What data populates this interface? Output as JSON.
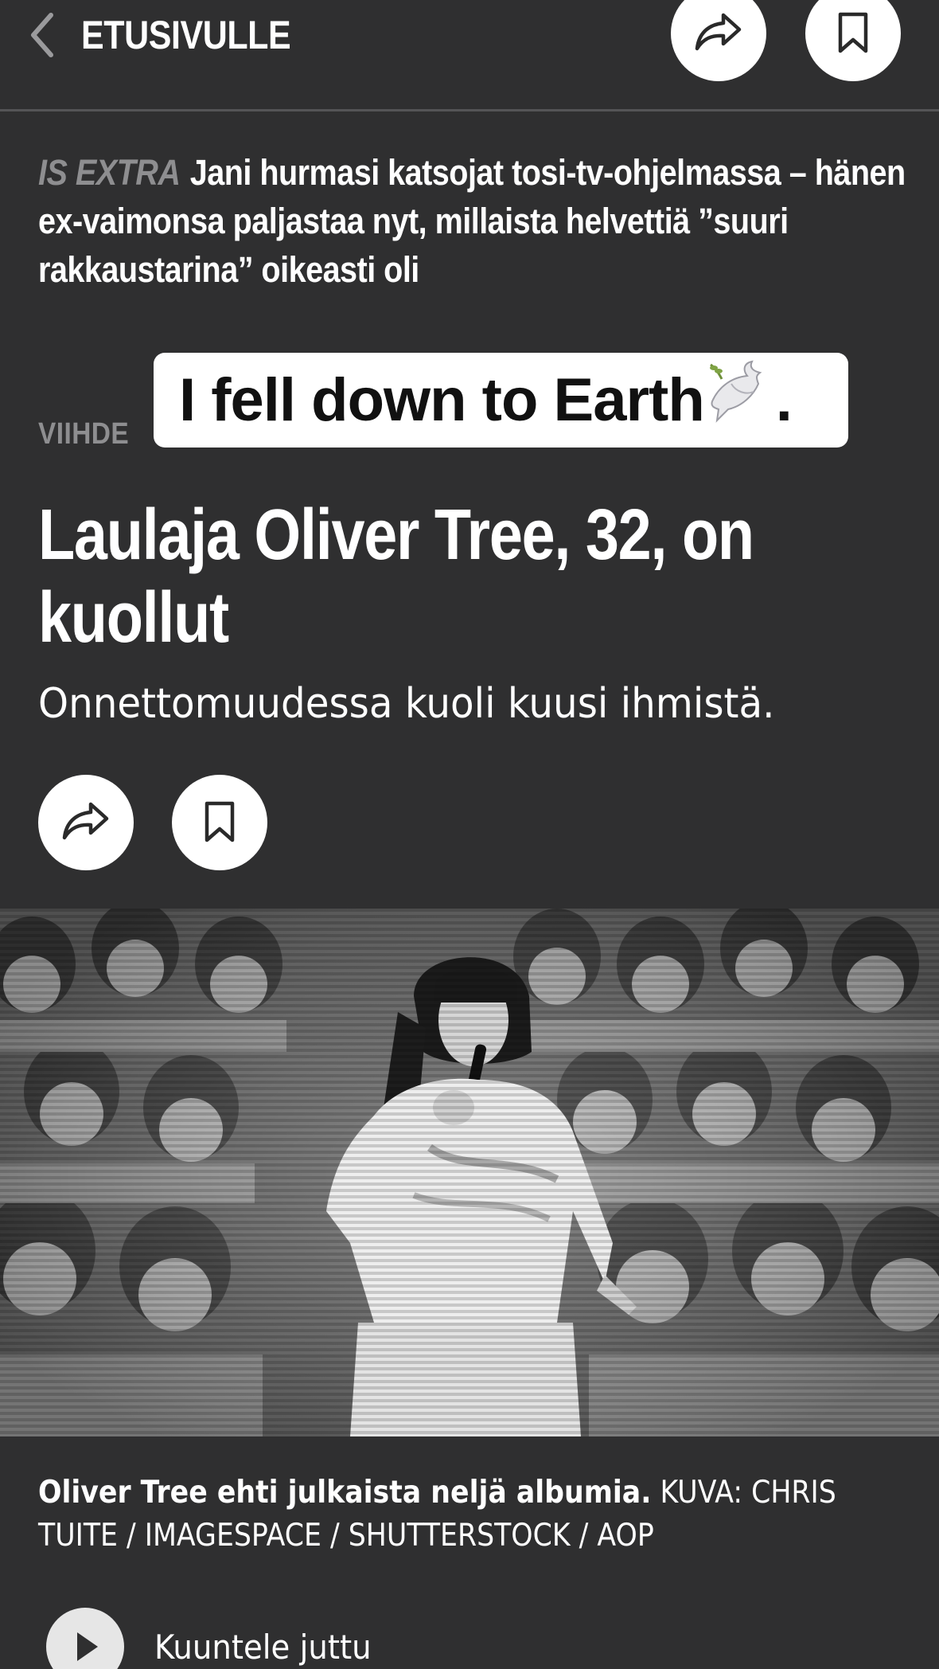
{
  "header": {
    "back_label": "ETUSIVULLE",
    "icons": {
      "back": "chevron-left-icon",
      "share": "share-icon",
      "bookmark": "bookmark-icon"
    }
  },
  "promo": {
    "brand": "IS EXTRA",
    "title": "Jani hurmasi katsojat tosi-tv-ohjelmassa – hänen ex-vaimonsa paljastaa nyt, millaista helvettiä ”suuri rakkaustarina” oikeasti oli"
  },
  "article": {
    "category": "VIIHDE",
    "sticker_text": "I fell down to Earth",
    "sticker_emoji": "🕊️",
    "sticker_end": ".",
    "headline": "Laulaja Oliver Tree, 32, on kuollut",
    "lead": "Onnettomuudessa kuoli kuusi ihmistä.",
    "image": {
      "caption": "Oliver Tree ehti julkaista neljä albumia.",
      "credit": "KUVA: CHRIS TUITE / IMAGESPACE / SHUTTERSTOCK / AOP"
    },
    "listen_label": "Kuuntele juttu"
  },
  "colors": {
    "background": "#2f2f30",
    "text": "#ffffff",
    "muted": "#8e8e90",
    "button_bg": "#ffffff",
    "divider": "#545456"
  }
}
